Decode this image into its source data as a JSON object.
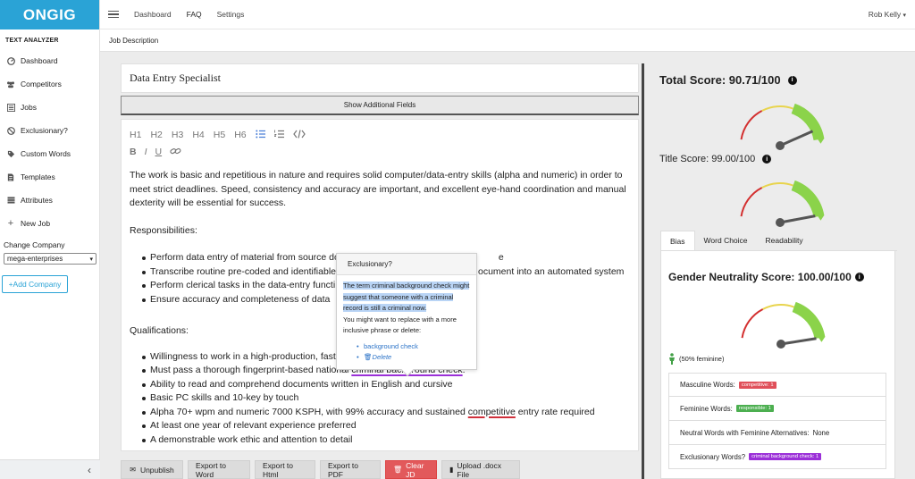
{
  "app": {
    "logo": "ONGIG",
    "section": "TEXT ANALYZER"
  },
  "sidebar": {
    "items": [
      {
        "label": "Dashboard",
        "icon": "dashboard-icon"
      },
      {
        "label": "Competitors",
        "icon": "users-icon"
      },
      {
        "label": "Jobs",
        "icon": "list-icon"
      },
      {
        "label": "Exclusionary?",
        "icon": "ban-icon"
      },
      {
        "label": "Custom Words",
        "icon": "tag-icon"
      },
      {
        "label": "Templates",
        "icon": "document-icon"
      },
      {
        "label": "Attributes",
        "icon": "table-icon"
      },
      {
        "label": "New Job",
        "icon": "plus-icon"
      }
    ],
    "change_company_label": "Change Company",
    "company_value": "mega-enterprises",
    "add_company": "+Add Company",
    "collapse_glyph": "‹"
  },
  "topbar": {
    "nav": [
      "Dashboard",
      "FAQ",
      "Settings"
    ],
    "user": "Rob Kelly"
  },
  "crumb": "Job Description",
  "editor": {
    "title": "Data Entry Specialist",
    "show_fields": "Show Additional Fields",
    "toolbar_headings": [
      "H1",
      "H2",
      "H3",
      "H4",
      "H5",
      "H6"
    ],
    "intro": "The work is basic and repetitious in nature and requires solid computer/data-entry skills (alpha and numeric) in order to meet strict deadlines. Speed, consistency and accuracy are important, and excellent eye-hand coordination and manual dexterity will be essential for success.",
    "responsibilities_heading": "Responsibilities:",
    "responsibilities": [
      {
        "text": "Perform data entry of material from source do",
        "tail": "e"
      },
      {
        "text": "Transcribe routine pre-coded and identifiable",
        "tail": "ocument into an automated system"
      },
      {
        "text": "Perform clerical tasks in the data-entry functi",
        "tail": ""
      },
      {
        "text": "Ensure accuracy and completeness of data",
        "tail": ""
      }
    ],
    "qualifications_heading": "Qualifications:",
    "qual1": "Willingness to work in a high-production, fast-p",
    "qual2_pre": "Must pass a thorough fingerprint-based national ",
    "qual2_flag": "criminal background check",
    "qual2_post": ".",
    "qual3": "Ability to read and comprehend documents written in English and cursive",
    "qual4": "Basic PC skills and 10-key by touch",
    "qual5_pre": "Alpha 70+ wpm and numeric 7000 KSPH, with 99% accuracy and sustained ",
    "qual5_flag": "competitive",
    "qual5_post": " entry rate required",
    "qual6": "At least one year of relevant experience preferred",
    "qual7": "A demonstrable work ethic and attention to detail"
  },
  "popover": {
    "title": "Exclusionary?",
    "highlighted": "The term criminal background check might suggest that someone with a criminal record is still a criminal now.",
    "body": "You might want to replace with a more inclusive phrase or delete:",
    "suggestion": "background check",
    "delete": "Delete"
  },
  "actions": [
    "Unpublish",
    "Export to Word",
    "Export to Html",
    "Export to PDF",
    "Clear JD",
    "Upload .docx File"
  ],
  "scores": {
    "total_label": "Total Score: 90.71/100",
    "title_label": "Title Score: 99.00/100",
    "tabs": [
      "Bias",
      "Word Choice",
      "Readability"
    ],
    "gender_label": "Gender Neutrality Score: 100.00/100",
    "feminine_pct": "(50% feminine)",
    "gauge_values": {
      "total": 90.71,
      "title": 99.0,
      "gender": 100.0
    },
    "rows": [
      {
        "label": "Masculine Words:",
        "badge": "competitive: 1",
        "color": "#e0505a"
      },
      {
        "label": "Feminine Words:",
        "badge": "responsible: 1",
        "color": "#4caf50"
      },
      {
        "label": "Neutral Words with Feminine Alternatives:",
        "value": "None"
      },
      {
        "label": "Exclusionary Words?",
        "badge": "criminal background check: 1",
        "color": "#9b30d8"
      }
    ]
  }
}
